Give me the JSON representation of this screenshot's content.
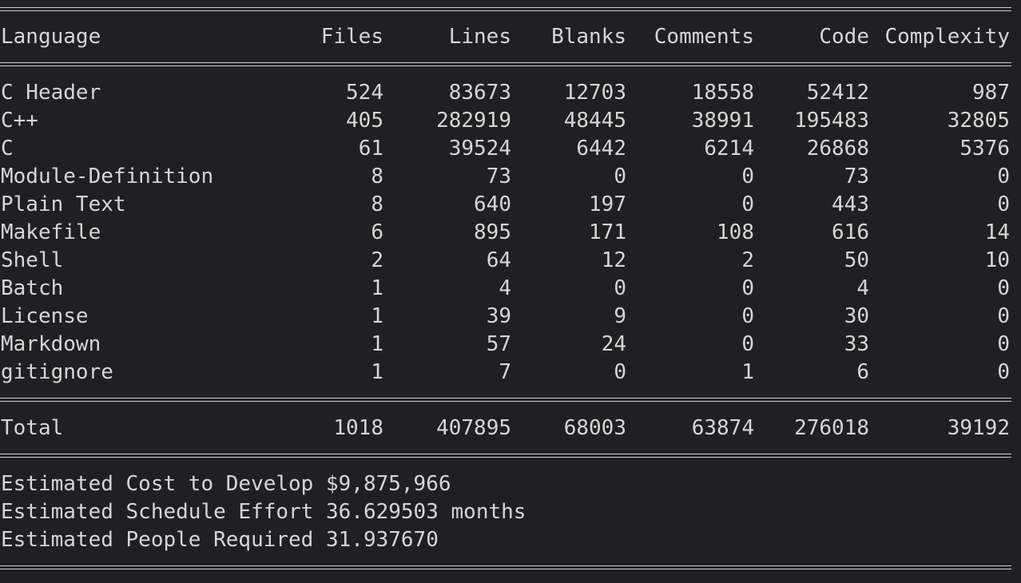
{
  "headers": {
    "language": "Language",
    "files": "Files",
    "lines": "Lines",
    "blanks": "Blanks",
    "comments": "Comments",
    "code": "Code",
    "complexity": "Complexity"
  },
  "rows": [
    {
      "language": "C Header",
      "files": "524",
      "lines": "83673",
      "blanks": "12703",
      "comments": "18558",
      "code": "52412",
      "complexity": "987"
    },
    {
      "language": "C++",
      "files": "405",
      "lines": "282919",
      "blanks": "48445",
      "comments": "38991",
      "code": "195483",
      "complexity": "32805"
    },
    {
      "language": "C",
      "files": "61",
      "lines": "39524",
      "blanks": "6442",
      "comments": "6214",
      "code": "26868",
      "complexity": "5376"
    },
    {
      "language": "Module-Definition",
      "files": "8",
      "lines": "73",
      "blanks": "0",
      "comments": "0",
      "code": "73",
      "complexity": "0"
    },
    {
      "language": "Plain Text",
      "files": "8",
      "lines": "640",
      "blanks": "197",
      "comments": "0",
      "code": "443",
      "complexity": "0"
    },
    {
      "language": "Makefile",
      "files": "6",
      "lines": "895",
      "blanks": "171",
      "comments": "108",
      "code": "616",
      "complexity": "14"
    },
    {
      "language": "Shell",
      "files": "2",
      "lines": "64",
      "blanks": "12",
      "comments": "2",
      "code": "50",
      "complexity": "10"
    },
    {
      "language": "Batch",
      "files": "1",
      "lines": "4",
      "blanks": "0",
      "comments": "0",
      "code": "4",
      "complexity": "0"
    },
    {
      "language": "License",
      "files": "1",
      "lines": "39",
      "blanks": "9",
      "comments": "0",
      "code": "30",
      "complexity": "0"
    },
    {
      "language": "Markdown",
      "files": "1",
      "lines": "57",
      "blanks": "24",
      "comments": "0",
      "code": "33",
      "complexity": "0"
    },
    {
      "language": "gitignore",
      "files": "1",
      "lines": "7",
      "blanks": "0",
      "comments": "1",
      "code": "6",
      "complexity": "0"
    }
  ],
  "total": {
    "language": "Total",
    "files": "1018",
    "lines": "407895",
    "blanks": "68003",
    "comments": "63874",
    "code": "276018",
    "complexity": "39192"
  },
  "estimates": {
    "cost": "Estimated Cost to Develop $9,875,966",
    "schedule": "Estimated Schedule Effort 36.629503 months",
    "people": "Estimated People Required 31.937670"
  }
}
